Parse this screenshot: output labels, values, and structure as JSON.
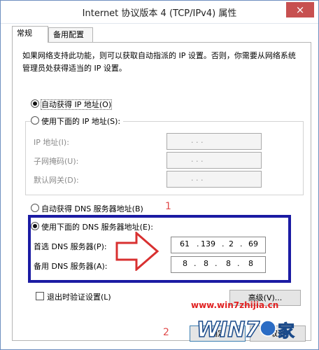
{
  "window": {
    "title": "Internet 协议版本 4 (TCP/IPv4) 属性",
    "close_glyph": "×"
  },
  "tabs": [
    {
      "label": "常规",
      "active": true
    },
    {
      "label": "备用配置",
      "active": false
    }
  ],
  "description": "如果网络支持此功能，则可以获取自动指派的 IP 设置。否则，你需要从网络系统管理员处获得适当的 IP 设置。",
  "ip_section": {
    "auto_radio": {
      "label": "自动获得 IP 地址(O)",
      "selected": true
    },
    "manual_radio": {
      "label": "使用下面的 IP 地址(S):",
      "selected": false
    },
    "fields": [
      {
        "label": "IP 地址(I):",
        "value": ".    .    ."
      },
      {
        "label": "子网掩码(U):",
        "value": ".    .    ."
      },
      {
        "label": "默认网关(D):",
        "value": ".    .    ."
      }
    ]
  },
  "dns_section": {
    "auto_radio": {
      "label": "自动获得 DNS 服务器地址(B)",
      "selected": false
    },
    "manual_radio": {
      "label": "使用下面的 DNS 服务器地址(E):",
      "selected": true
    },
    "preferred": {
      "label": "首选 DNS 服务器(P):",
      "octets": [
        "61",
        "139",
        "2",
        "69"
      ]
    },
    "alternate": {
      "label": "备用 DNS 服务器(A):",
      "octets": [
        "8",
        "8",
        "8",
        "8"
      ]
    }
  },
  "annotations": {
    "step1": "1",
    "step2": "2"
  },
  "validate_checkbox": {
    "label": "退出时验证设置(L)",
    "checked": false
  },
  "buttons": {
    "advanced": "高级(V)...",
    "ok": "确定",
    "cancel": "取消"
  },
  "watermark": {
    "url": "www.win7zhijia.cn",
    "logo_text": "WIN7",
    "logo_suffix": "家",
    "color": "#e02020"
  },
  "colors": {
    "highlight_box": "#1b1ba3",
    "arrow": "#d83030",
    "annotation": "#e04a4a"
  }
}
